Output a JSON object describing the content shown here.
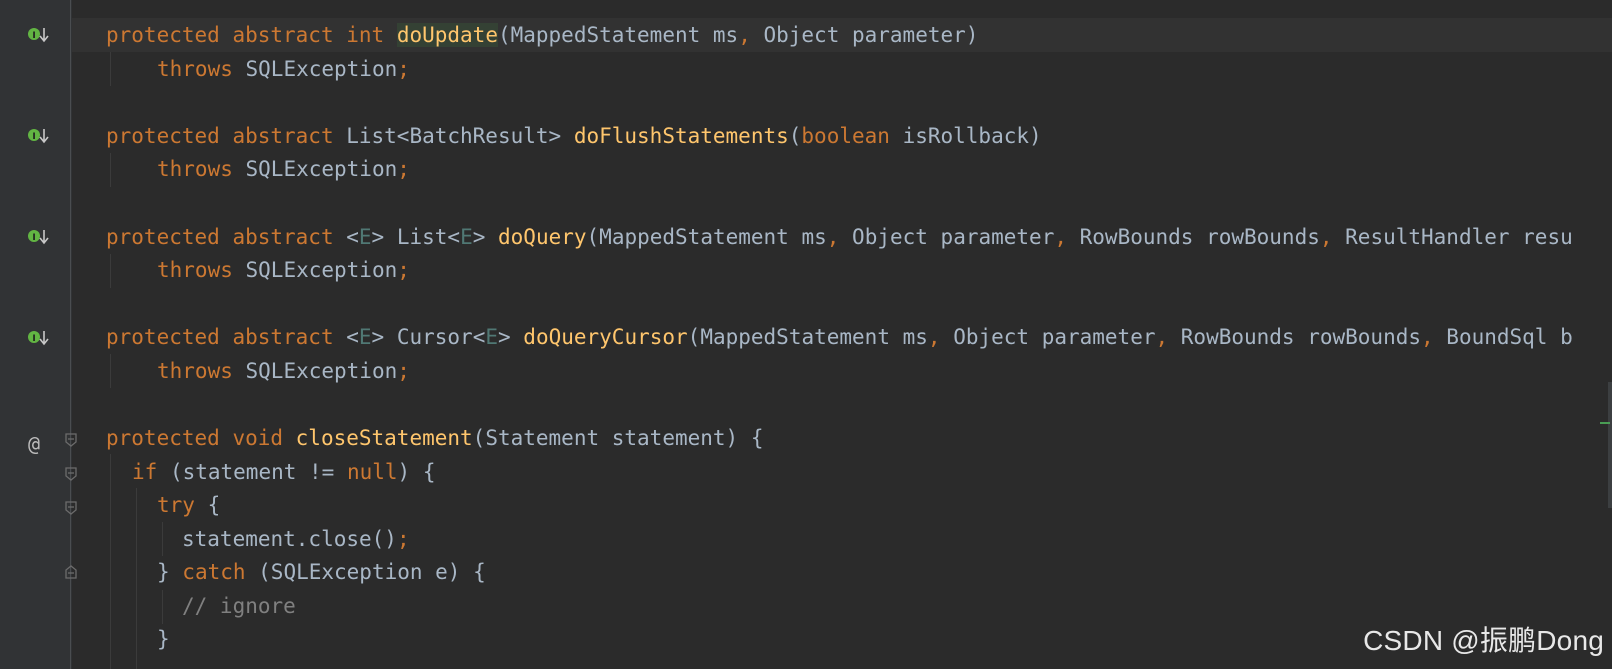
{
  "editor": {
    "lines": [
      {
        "id": "l1",
        "tokens": [
          [
            "kw",
            "protected "
          ],
          [
            "kw",
            "abstract "
          ],
          [
            "kw",
            "int "
          ],
          [
            "fn hl",
            "doUpdate"
          ],
          [
            "ty",
            "(MappedStatement ms"
          ],
          [
            "pn",
            ", "
          ],
          [
            "ty",
            "Object parameter)"
          ]
        ]
      },
      {
        "id": "l2",
        "tokens": [
          [
            "kw",
            "throws "
          ],
          [
            "ty",
            "SQLException"
          ],
          [
            "pn",
            ";"
          ]
        ]
      },
      {
        "id": "l3",
        "tokens": [
          [
            "kw",
            "protected "
          ],
          [
            "kw",
            "abstract "
          ],
          [
            "ty",
            "List<BatchResult> "
          ],
          [
            "fn",
            "doFlushStatements"
          ],
          [
            "ty",
            "("
          ],
          [
            "kw",
            "boolean "
          ],
          [
            "ty",
            "isRollback)"
          ]
        ]
      },
      {
        "id": "l4",
        "tokens": [
          [
            "kw",
            "throws "
          ],
          [
            "ty",
            "SQLException"
          ],
          [
            "pn",
            ";"
          ]
        ]
      },
      {
        "id": "l5",
        "tokens": [
          [
            "kw",
            "protected "
          ],
          [
            "kw",
            "abstract "
          ],
          [
            "ty",
            "<"
          ],
          [
            "tp",
            "E"
          ],
          [
            "ty",
            "> List<"
          ],
          [
            "tp",
            "E"
          ],
          [
            "ty",
            "> "
          ],
          [
            "fn",
            "doQuery"
          ],
          [
            "ty",
            "(MappedStatement ms"
          ],
          [
            "pn",
            ", "
          ],
          [
            "ty",
            "Object parameter"
          ],
          [
            "pn",
            ", "
          ],
          [
            "ty",
            "RowBounds rowBounds"
          ],
          [
            "pn",
            ", "
          ],
          [
            "ty",
            "ResultHandler resu"
          ]
        ]
      },
      {
        "id": "l6",
        "tokens": [
          [
            "kw",
            "throws "
          ],
          [
            "ty",
            "SQLException"
          ],
          [
            "pn",
            ";"
          ]
        ]
      },
      {
        "id": "l7",
        "tokens": [
          [
            "kw",
            "protected "
          ],
          [
            "kw",
            "abstract "
          ],
          [
            "ty",
            "<"
          ],
          [
            "tp",
            "E"
          ],
          [
            "ty",
            "> Cursor<"
          ],
          [
            "tp",
            "E"
          ],
          [
            "ty",
            "> "
          ],
          [
            "fn",
            "doQueryCursor"
          ],
          [
            "ty",
            "(MappedStatement ms"
          ],
          [
            "pn",
            ", "
          ],
          [
            "ty",
            "Object parameter"
          ],
          [
            "pn",
            ", "
          ],
          [
            "ty",
            "RowBounds rowBounds"
          ],
          [
            "pn",
            ", "
          ],
          [
            "ty",
            "BoundSql b"
          ]
        ]
      },
      {
        "id": "l8",
        "tokens": [
          [
            "kw",
            "throws "
          ],
          [
            "ty",
            "SQLException"
          ],
          [
            "pn",
            ";"
          ]
        ]
      },
      {
        "id": "l9",
        "tokens": [
          [
            "kw",
            "protected "
          ],
          [
            "kw",
            "void "
          ],
          [
            "fn",
            "closeStatement"
          ],
          [
            "ty",
            "(Statement statement) {"
          ]
        ]
      },
      {
        "id": "l10",
        "tokens": [
          [
            "kw",
            "if "
          ],
          [
            "ty",
            "(statement != "
          ],
          [
            "kw",
            "null"
          ],
          [
            "ty",
            ") {"
          ]
        ]
      },
      {
        "id": "l11",
        "tokens": [
          [
            "kw",
            "try "
          ],
          [
            "ty",
            "{"
          ]
        ]
      },
      {
        "id": "l12",
        "tokens": [
          [
            "ty",
            "statement.close()"
          ],
          [
            "pn",
            ";"
          ]
        ]
      },
      {
        "id": "l13",
        "tokens": [
          [
            "ty",
            "} "
          ],
          [
            "kw",
            "catch "
          ],
          [
            "ty",
            "(SQLException e) {"
          ]
        ]
      },
      {
        "id": "l14",
        "tokens": [
          [
            "cm",
            "// ignore"
          ]
        ]
      },
      {
        "id": "l15",
        "tokens": [
          [
            "ty",
            "}"
          ]
        ]
      }
    ],
    "gutter_at_symbol": "@"
  },
  "watermark": "CSDN @振鹏Dong",
  "colors": {
    "background": "#2b2b2b",
    "keyword": "#cc7832",
    "function": "#ffc66d",
    "text": "#a9b7c6",
    "type_param": "#507874",
    "comment": "#808080"
  }
}
